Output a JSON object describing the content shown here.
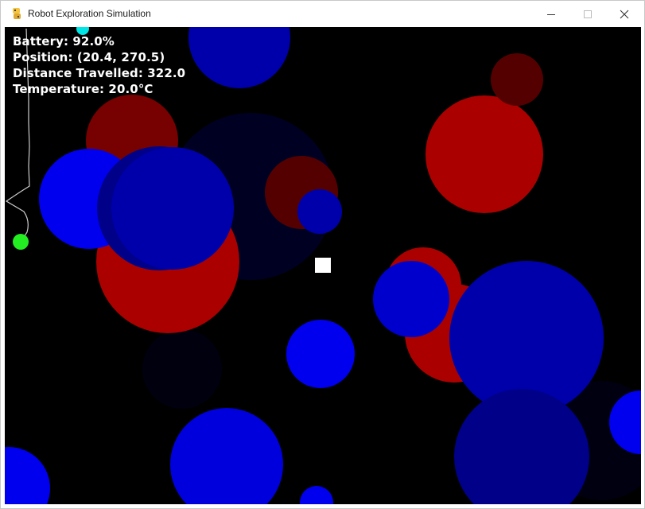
{
  "window": {
    "title": "Robot Exploration Simulation",
    "controls": [
      "minimize",
      "maximize",
      "close"
    ]
  },
  "hud": {
    "battery": "Battery: 92.0%",
    "position": "Position: (20.4, 270.5)",
    "distance": "Distance Travelled: 322.0",
    "temperature": "Temperature: 20.0°C"
  },
  "colors": {
    "background": "#000000",
    "robot": "#22ee22",
    "target": "#ffffff",
    "path": "#cccccc",
    "marker": "#00e5e5",
    "hot_bright": "#aa0000",
    "hot_mid": "#770000",
    "hot_dark": "#550000",
    "cold_bright": "#0000ee",
    "cold_mid": "#0000aa",
    "cold_dark": "#000088",
    "cold_faint": "#000022"
  },
  "icons": {
    "app": "python-snake-icon",
    "minimize": "minimize-icon",
    "maximize": "maximize-icon",
    "close": "close-icon"
  }
}
